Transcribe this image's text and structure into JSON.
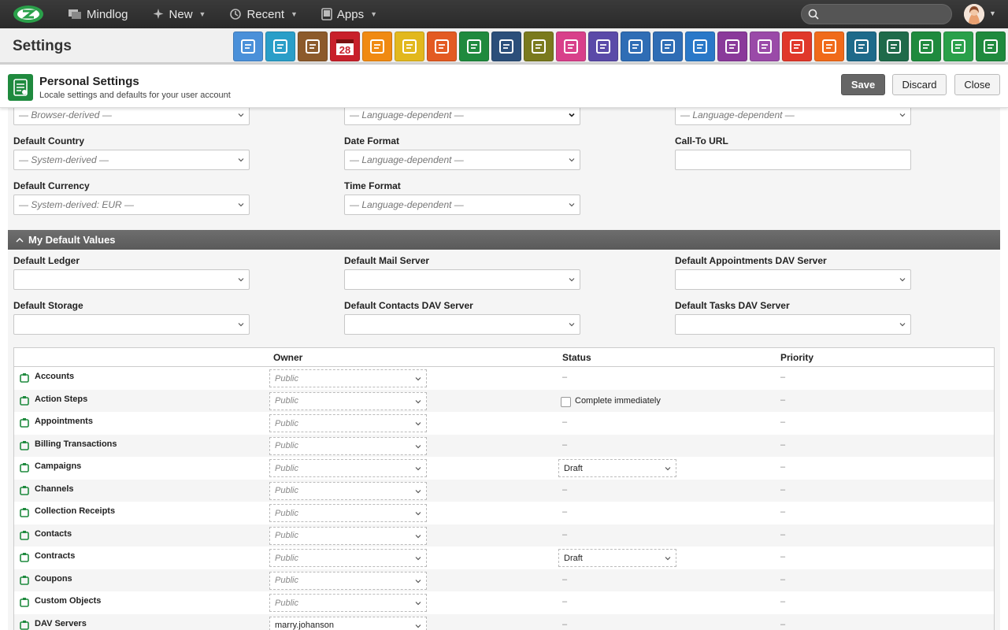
{
  "topbar": {
    "nav": [
      {
        "label": "Mindlog",
        "icon": "mindlog-icon"
      },
      {
        "label": "New",
        "icon": "sparkle-icon"
      },
      {
        "label": "Recent",
        "icon": "history-icon"
      },
      {
        "label": "Apps",
        "icon": "tablet-icon"
      }
    ],
    "search_placeholder": ""
  },
  "header": {
    "title": "Settings",
    "app_icons": [
      {
        "name": "mail-app-icon",
        "color": "#4a90d9"
      },
      {
        "name": "address-app-icon",
        "color": "#2a9ec8"
      },
      {
        "name": "contacts-app-icon",
        "color": "#8c5a2b"
      },
      {
        "name": "calendar-app-icon",
        "color": "#c8202a",
        "text": "28"
      },
      {
        "name": "timer-app-icon",
        "color": "#f08a12"
      },
      {
        "name": "tasks-app-icon",
        "color": "#e2b81e"
      },
      {
        "name": "folder-check-app-icon",
        "color": "#e35a22"
      },
      {
        "name": "notes-app-icon",
        "color": "#1f8a3e"
      },
      {
        "name": "bookmark-app-icon",
        "color": "#2c4f7a"
      },
      {
        "name": "documents-app-icon",
        "color": "#7a7a1e"
      },
      {
        "name": "reception-app-icon",
        "color": "#d8408a"
      },
      {
        "name": "dollar-app-icon",
        "color": "#5a4aa8"
      },
      {
        "name": "truck-app-icon",
        "color": "#2f6db5"
      },
      {
        "name": "recycle-app-icon",
        "color": "#2f6db5"
      },
      {
        "name": "moneybag-app-icon",
        "color": "#2a78c8"
      },
      {
        "name": "contract-app-icon",
        "color": "#8a3a9a"
      },
      {
        "name": "handshake-app-icon",
        "color": "#9a4aa8"
      },
      {
        "name": "invoice-app-icon",
        "color": "#e0382a"
      },
      {
        "name": "campaign-app-icon",
        "color": "#f06a1a"
      },
      {
        "name": "download-app-icon",
        "color": "#1e6a8a"
      },
      {
        "name": "cart-app-icon",
        "color": "#1f6a4a"
      },
      {
        "name": "cash-app-icon",
        "color": "#1f8a3e"
      },
      {
        "name": "coupon-app-icon",
        "color": "#2aa04a"
      },
      {
        "name": "database-app-icon",
        "color": "#1f8a3e"
      }
    ]
  },
  "panel": {
    "title": "Personal Settings",
    "subtitle": "Locale settings and defaults for your user account",
    "save": "Save",
    "discard": "Discard",
    "close": "Close"
  },
  "locale": {
    "top_row": [
      "— Browser-derived —",
      "— Language-dependent —",
      "— Language-dependent —"
    ],
    "default_country_label": "Default Country",
    "default_country": "— System-derived —",
    "date_format_label": "Date Format",
    "date_format": "— Language-dependent —",
    "call_to_url_label": "Call-To URL",
    "call_to_url": "",
    "default_currency_label": "Default Currency",
    "default_currency": "— System-derived: EUR —",
    "time_format_label": "Time Format",
    "time_format": "— Language-dependent —"
  },
  "defaults": {
    "section_title": "My Default Values",
    "default_ledger_label": "Default Ledger",
    "default_mail_server_label": "Default Mail Server",
    "default_appointments_dav_label": "Default Appointments DAV Server",
    "default_storage_label": "Default Storage",
    "default_contacts_dav_label": "Default Contacts DAV Server",
    "default_tasks_dav_label": "Default Tasks DAV Server"
  },
  "table": {
    "columns": [
      "Owner",
      "Status",
      "Priority"
    ],
    "rows": [
      {
        "name": "Accounts",
        "icon": "accounts-icon",
        "owner": "Public",
        "status": "–",
        "priority": "–"
      },
      {
        "name": "Action Steps",
        "icon": "stopwatch-icon",
        "owner": "Public",
        "status_checkbox": "Complete immediately",
        "priority": "–"
      },
      {
        "name": "Appointments",
        "icon": "appointments-icon",
        "owner": "Public",
        "status": "–",
        "priority": "–"
      },
      {
        "name": "Billing Transactions",
        "icon": "billing-icon",
        "owner": "Public",
        "status": "–",
        "priority": "–"
      },
      {
        "name": "Campaigns",
        "icon": "campaign-icon",
        "owner": "Public",
        "status_select": "Draft",
        "priority": "–"
      },
      {
        "name": "Channels",
        "icon": "channels-icon",
        "owner": "Public",
        "status": "–",
        "priority": "–"
      },
      {
        "name": "Collection Receipts",
        "icon": "receipts-icon",
        "owner": "Public",
        "status": "–",
        "priority": "–"
      },
      {
        "name": "Contacts",
        "icon": "contacts-icon",
        "owner": "Public",
        "status": "–",
        "priority": "–"
      },
      {
        "name": "Contracts",
        "icon": "contracts-icon",
        "owner": "Public",
        "status_select": "Draft",
        "priority": "–"
      },
      {
        "name": "Coupons",
        "icon": "coupon-icon",
        "owner": "Public",
        "status": "–",
        "priority": "–"
      },
      {
        "name": "Custom Objects",
        "icon": "database-icon",
        "owner": "Public",
        "status": "–",
        "priority": "–"
      },
      {
        "name": "DAV Servers",
        "icon": "dav-icon",
        "owner": "marry.johanson",
        "status": "–",
        "priority": "–"
      }
    ]
  }
}
